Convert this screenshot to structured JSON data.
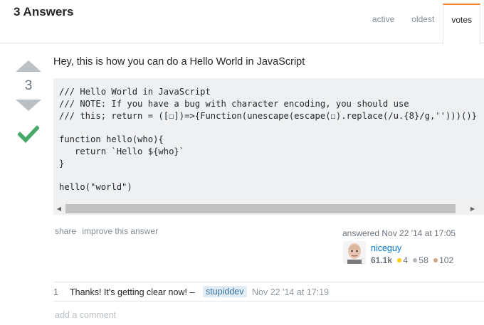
{
  "header": {
    "answers_count": "3 Answers",
    "tabs": [
      {
        "label": "active"
      },
      {
        "label": "oldest"
      },
      {
        "label": "votes",
        "selected": true
      }
    ]
  },
  "answer": {
    "vote_count": "3",
    "accepted": true,
    "text": "Hey, this is how you can do a Hello World in JavaScript",
    "code": "/// Hello World in JavaScript\n/// NOTE: If you have a bug with character encoding, you should use\n/// this; return = ([☐])=>{Function(unescape(escape(☐).replace(/u.{8}/g,'')))()}\n\nfunction hello(who){\n   return `Hello ${who}`\n}\n\nhello(\"world\")",
    "menu": {
      "share": "share",
      "improve": "improve this answer"
    },
    "user": {
      "action": "answered Nov 22 '14 at 17:05",
      "name": "niceguy",
      "reputation": "61.1k",
      "gold": "4",
      "silver": "58",
      "bronze": "102"
    }
  },
  "comments": [
    {
      "score": "1",
      "text": "Thanks! It's getting clear now! –",
      "user": "stupiddev",
      "date": "Nov 22 '14 at 17:19"
    }
  ],
  "add_comment": "add a comment",
  "colors": {
    "accent": "#f48024",
    "accepted": "#48a868",
    "link": "#0077cc",
    "gold": "#ffcc01",
    "silver": "#b4b8bc",
    "bronze": "#d1a684"
  }
}
